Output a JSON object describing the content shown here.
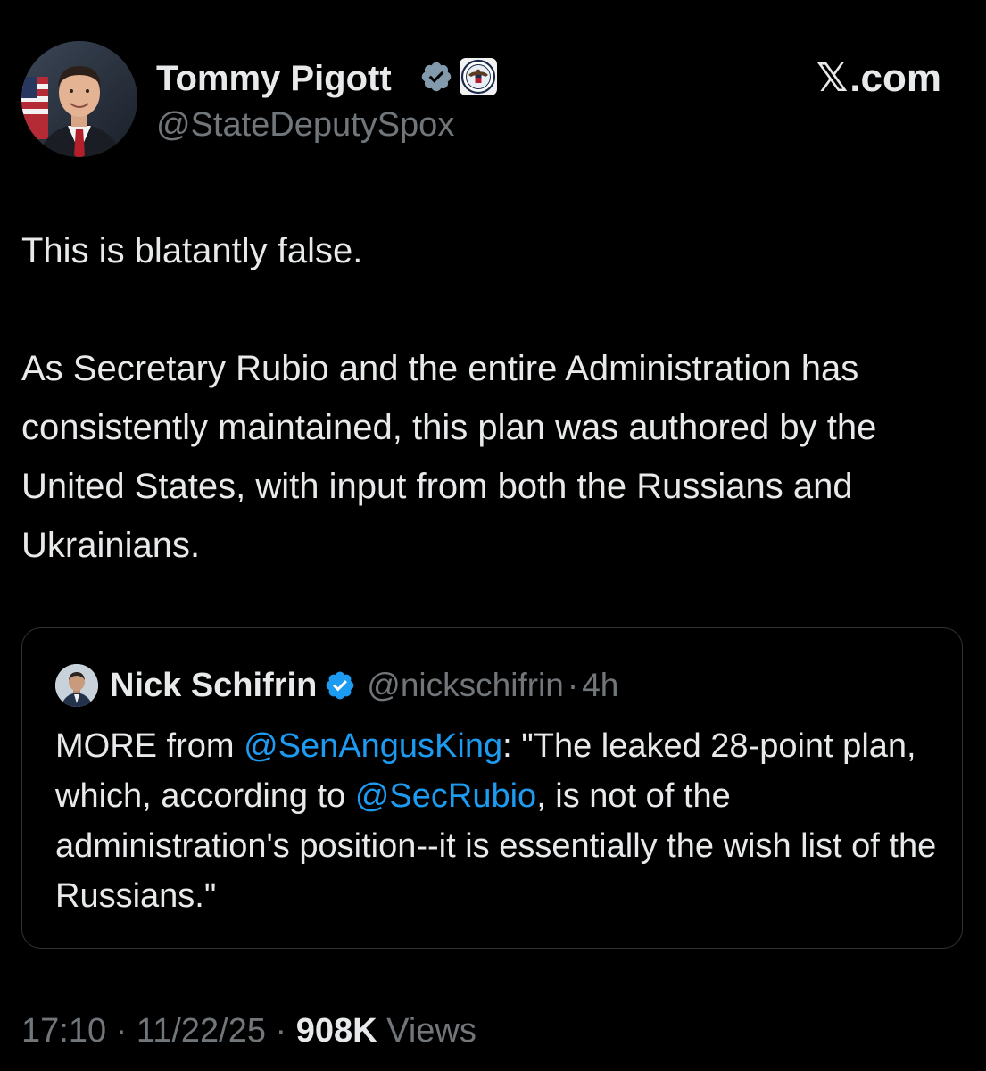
{
  "author": {
    "name": "Tommy Pigott",
    "handle": "@StateDeputySpox",
    "verified": true,
    "badges": [
      "verified-checkmark-icon",
      "state-department-seal-icon"
    ]
  },
  "brand": {
    "label": ".com"
  },
  "post": {
    "line1": "This is blatantly false.",
    "line2": "As Secretary Rubio and the entire Administration has consistently maintained, this plan was authored by the United States, with input from both the Russians and Ukrainians."
  },
  "quoted_post": {
    "author_name": "Nick Schifrin",
    "author_handle": "@nickschifrin",
    "separator": "·",
    "time": "4h",
    "verified": true,
    "text_parts": [
      {
        "text": "MORE from ",
        "mention": false
      },
      {
        "text": "@SenAngusKing",
        "mention": true
      },
      {
        "text": ": \"The leaked 28-point plan, which, according to ",
        "mention": false
      },
      {
        "text": "@SecRubio",
        "mention": true
      },
      {
        "text": ", is not of the administration's position--it is essentially the wish list of the Russians.\"",
        "mention": false
      }
    ]
  },
  "meta": {
    "time": "17:10",
    "sep1": " · ",
    "date": "11/22/25",
    "sep2": " · ",
    "views_count": "908K",
    "views_label": " Views"
  },
  "colors": {
    "background": "#000000",
    "text": "#e7e9ea",
    "secondary": "#71767b",
    "link": "#1d9bf0",
    "verified": "#829aab",
    "border": "#2f3336"
  }
}
